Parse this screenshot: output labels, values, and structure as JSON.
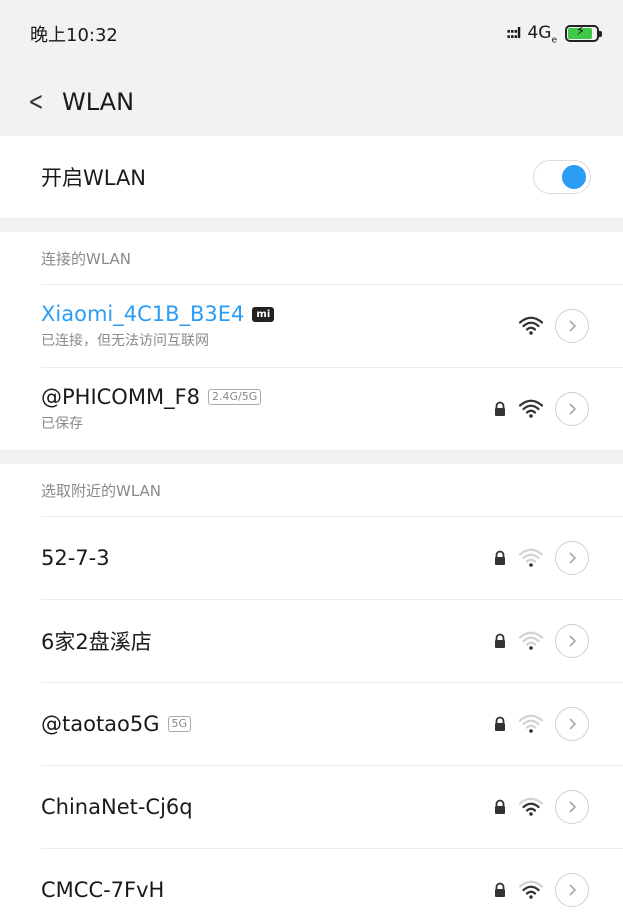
{
  "status_bar": {
    "time": "晚上10:32",
    "signal": ":::l",
    "network": "4G",
    "network_sub": "e",
    "battery_level_percent": 85,
    "battery_charging": true
  },
  "header": {
    "title": "WLAN"
  },
  "wlan_toggle": {
    "label": "开启WLAN",
    "enabled": true
  },
  "connected_section": {
    "title": "连接的WLAN",
    "networks": [
      {
        "name": "Xiaomi_4C1B_B3E4",
        "badge": "mi",
        "status": "已连接，但无法访问互联网",
        "locked": false,
        "signal_strength": "strong"
      },
      {
        "name": "@PHICOMM_F8",
        "tag": "2.4G/5G",
        "status": "已保存",
        "locked": true,
        "signal_strength": "strong"
      }
    ]
  },
  "nearby_section": {
    "title": "选取附近的WLAN",
    "networks": [
      {
        "name": "52-7-3",
        "locked": true,
        "signal_strength": "weak"
      },
      {
        "name": "6家2盘溪店",
        "locked": true,
        "signal_strength": "weak"
      },
      {
        "name": "@taotao5G",
        "tag": "5G",
        "locked": true,
        "signal_strength": "weak"
      },
      {
        "name": "ChinaNet-Cj6q",
        "locked": true,
        "signal_strength": "medium"
      },
      {
        "name": "CMCC-7FvH",
        "locked": true,
        "signal_strength": "medium"
      }
    ]
  },
  "colors": {
    "accent": "#2b9df5",
    "wifi_strong": "#333333",
    "wifi_weak": "#d2d2d2",
    "text_secondary": "#8a8a8a"
  }
}
